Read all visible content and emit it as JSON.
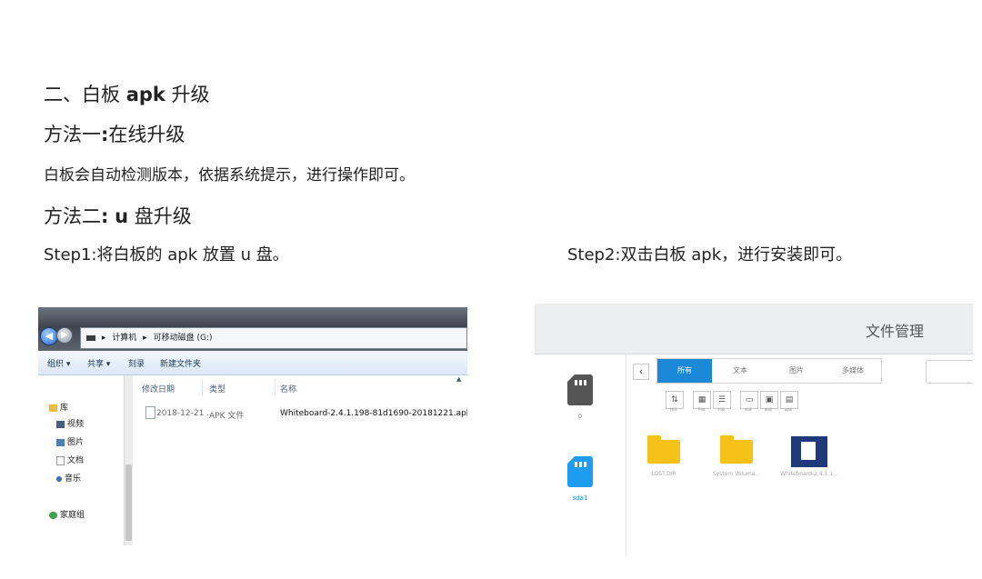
{
  "doc": {
    "heading_main_prefix": "二、白板",
    "heading_main_apk": "apk",
    "heading_main_suffix": "升级",
    "method1_prefix": "方法一",
    "method1_colon": ":",
    "method1_suffix": "在线升级",
    "method1_desc": "白板会自动检测版本，依据系统提示，进行操作即可。",
    "method2_prefix": "方法二",
    "method2_colon": ":",
    "method2_u": "u",
    "method2_suffix": "盘升级",
    "step1_prefix": "Step1:",
    "step1_text": "将白板的",
    "step1_apk": "apk",
    "step1_text2": "放置",
    "step1_u": "u",
    "step1_text3": "盘。",
    "step2_prefix": "Step2:",
    "step2_text": "双击白板",
    "step2_apk": "apk",
    "step2_text2": "，进行安装即可。"
  },
  "explorer": {
    "path": [
      "计算机",
      "可移动磁盘 (G:)"
    ],
    "toolbar": [
      "组织 ▾",
      "共享 ▾",
      "刻录",
      "新建文件夹"
    ],
    "sidebar": [
      "库",
      "视频",
      "图片",
      "文档",
      "音乐",
      "家庭组"
    ],
    "columns": [
      "修改日期",
      "类型",
      "名称"
    ],
    "file": {
      "date": "2018-12-21 ...",
      "type": "APK 文件",
      "name": "Whiteboard-2.4.1.198-81d1690-20181221.apk"
    },
    "colors": {
      "accent": "#2468c8"
    }
  },
  "file_manager": {
    "title": "文件管理",
    "storages": [
      {
        "label": "0",
        "color": "#555555"
      },
      {
        "label": "sda1",
        "color": "#1e9cf0"
      }
    ],
    "tabs": [
      "所有",
      "文本",
      "图片",
      "多媒体"
    ],
    "active_tab": "所有",
    "tools": [
      "排序",
      "平铺",
      "列表",
      "新建",
      "新建",
      "编辑"
    ],
    "items": [
      {
        "label": "LOST.DIR",
        "icon": "folder-icon"
      },
      {
        "label": "System Volume...",
        "icon": "folder-icon"
      },
      {
        "label": "Whiteboard-2.4.1.1...",
        "icon": "apk-icon"
      }
    ],
    "colors": {
      "accent": "#1e88d8",
      "folder": "#f6c21a"
    }
  }
}
